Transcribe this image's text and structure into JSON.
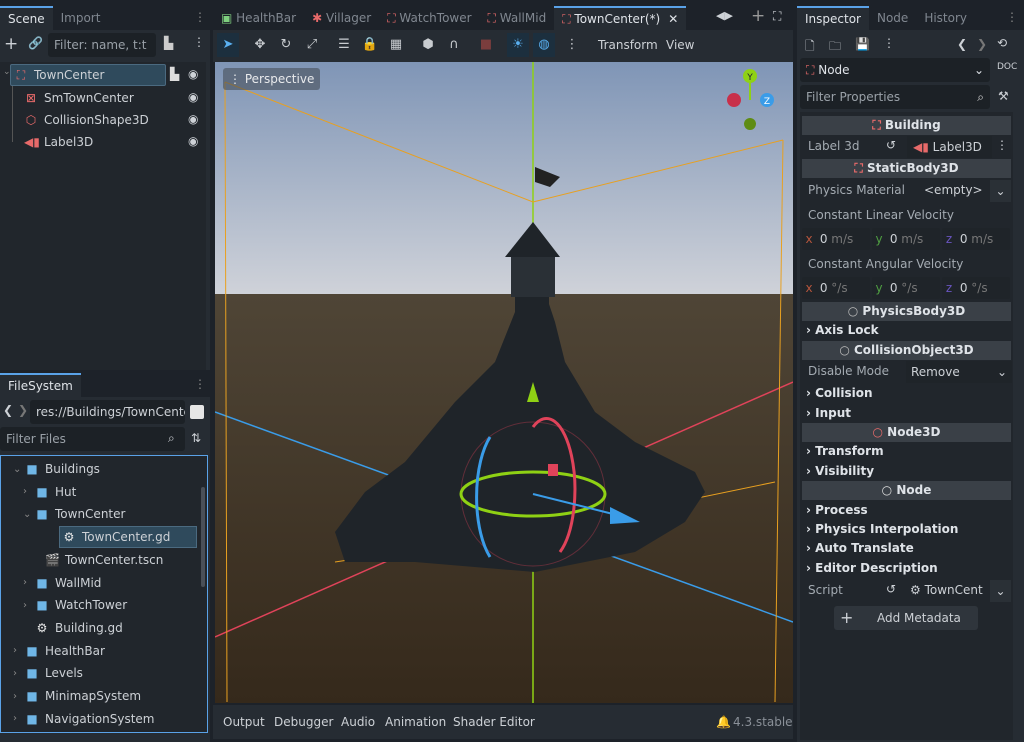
{
  "scene_panel": {
    "tabs": [
      "Scene",
      "Import"
    ],
    "filter_placeholder": "Filter: name, t:t",
    "tree": [
      {
        "name": "TownCenter",
        "icon": "node3d-icon",
        "color": "#e86a6a",
        "selected": true
      },
      {
        "name": "SmTownCenter",
        "icon": "mesh-instance-icon",
        "color": "#e86a6a"
      },
      {
        "name": "CollisionShape3D",
        "icon": "collision-shape-icon",
        "color": "#e86a6a"
      },
      {
        "name": "Label3D",
        "icon": "label-icon",
        "color": "#e86a6a"
      }
    ]
  },
  "filesystem": {
    "tab": "FileSystem",
    "path": "res://Buildings/TownCenter",
    "filter_placeholder": "Filter Files",
    "items": [
      {
        "name": "Buildings",
        "type": "folder",
        "depth": 0,
        "open": true
      },
      {
        "name": "Hut",
        "type": "folder",
        "depth": 1
      },
      {
        "name": "TownCenter",
        "type": "folder",
        "depth": 1,
        "open": true
      },
      {
        "name": "TownCenter.gd",
        "type": "script",
        "depth": 2,
        "selected": true
      },
      {
        "name": "TownCenter.tscn",
        "type": "scene",
        "depth": 2
      },
      {
        "name": "WallMid",
        "type": "folder",
        "depth": 1
      },
      {
        "name": "WatchTower",
        "type": "folder",
        "depth": 1
      },
      {
        "name": "Building.gd",
        "type": "script",
        "depth": 1
      },
      {
        "name": "HealthBar",
        "type": "folder",
        "depth": 0
      },
      {
        "name": "Levels",
        "type": "folder",
        "depth": 0
      },
      {
        "name": "MinimapSystem",
        "type": "folder",
        "depth": 0
      },
      {
        "name": "NavigationSystem",
        "type": "folder",
        "depth": 0
      }
    ]
  },
  "editor_tabs": [
    {
      "label": "HealthBar"
    },
    {
      "label": "Villager"
    },
    {
      "label": "WatchTower"
    },
    {
      "label": "WallMid"
    },
    {
      "label": "TownCenter(*)",
      "active": true
    }
  ],
  "toolbar": {
    "transform": "Transform",
    "view": "View"
  },
  "viewport": {
    "mode": "Perspective",
    "gizmo_axes": [
      "Y",
      "Z"
    ]
  },
  "bottom": {
    "tabs": [
      "Output",
      "Debugger",
      "Audio",
      "Animation",
      "Shader Editor"
    ],
    "version": "4.3.stable"
  },
  "inspector": {
    "tabs": [
      "Inspector",
      "Node",
      "History"
    ],
    "node": "Node",
    "filter_placeholder": "Filter Properties",
    "building": "Building",
    "label3d_prop": "Label 3d",
    "label3d_val": "Label3D",
    "staticbody": "StaticBody3D",
    "physics_material": "Physics Material",
    "physics_material_val": "<empty>",
    "lin_vel": "Constant Linear Velocity",
    "lin": {
      "x": "0",
      "y": "0",
      "z": "0",
      "unit": "m/s"
    },
    "ang_vel": "Constant Angular Velocity",
    "ang": {
      "x": "0",
      "y": "0",
      "z": "0",
      "unit": "°/s"
    },
    "physicsbody": "PhysicsBody3D",
    "axis_lock": "Axis Lock",
    "collisionobject": "CollisionObject3D",
    "disable_mode": "Disable Mode",
    "disable_mode_val": "Remove",
    "collision": "Collision",
    "input": "Input",
    "node3d": "Node3D",
    "transform": "Transform",
    "visibility": "Visibility",
    "process": "Process",
    "physics_interp": "Physics Interpolation",
    "auto_translate": "Auto Translate",
    "editor_desc": "Editor Description",
    "script": "Script",
    "script_val": "TownCent",
    "add_metadata": "Add Metadata"
  },
  "colors": {
    "accent": "#5aa2e8",
    "node_red": "#e86a6a",
    "folder": "#6fb6e6",
    "x": "#e0435a",
    "y": "#8fd114",
    "z": "#3a9ce8"
  }
}
